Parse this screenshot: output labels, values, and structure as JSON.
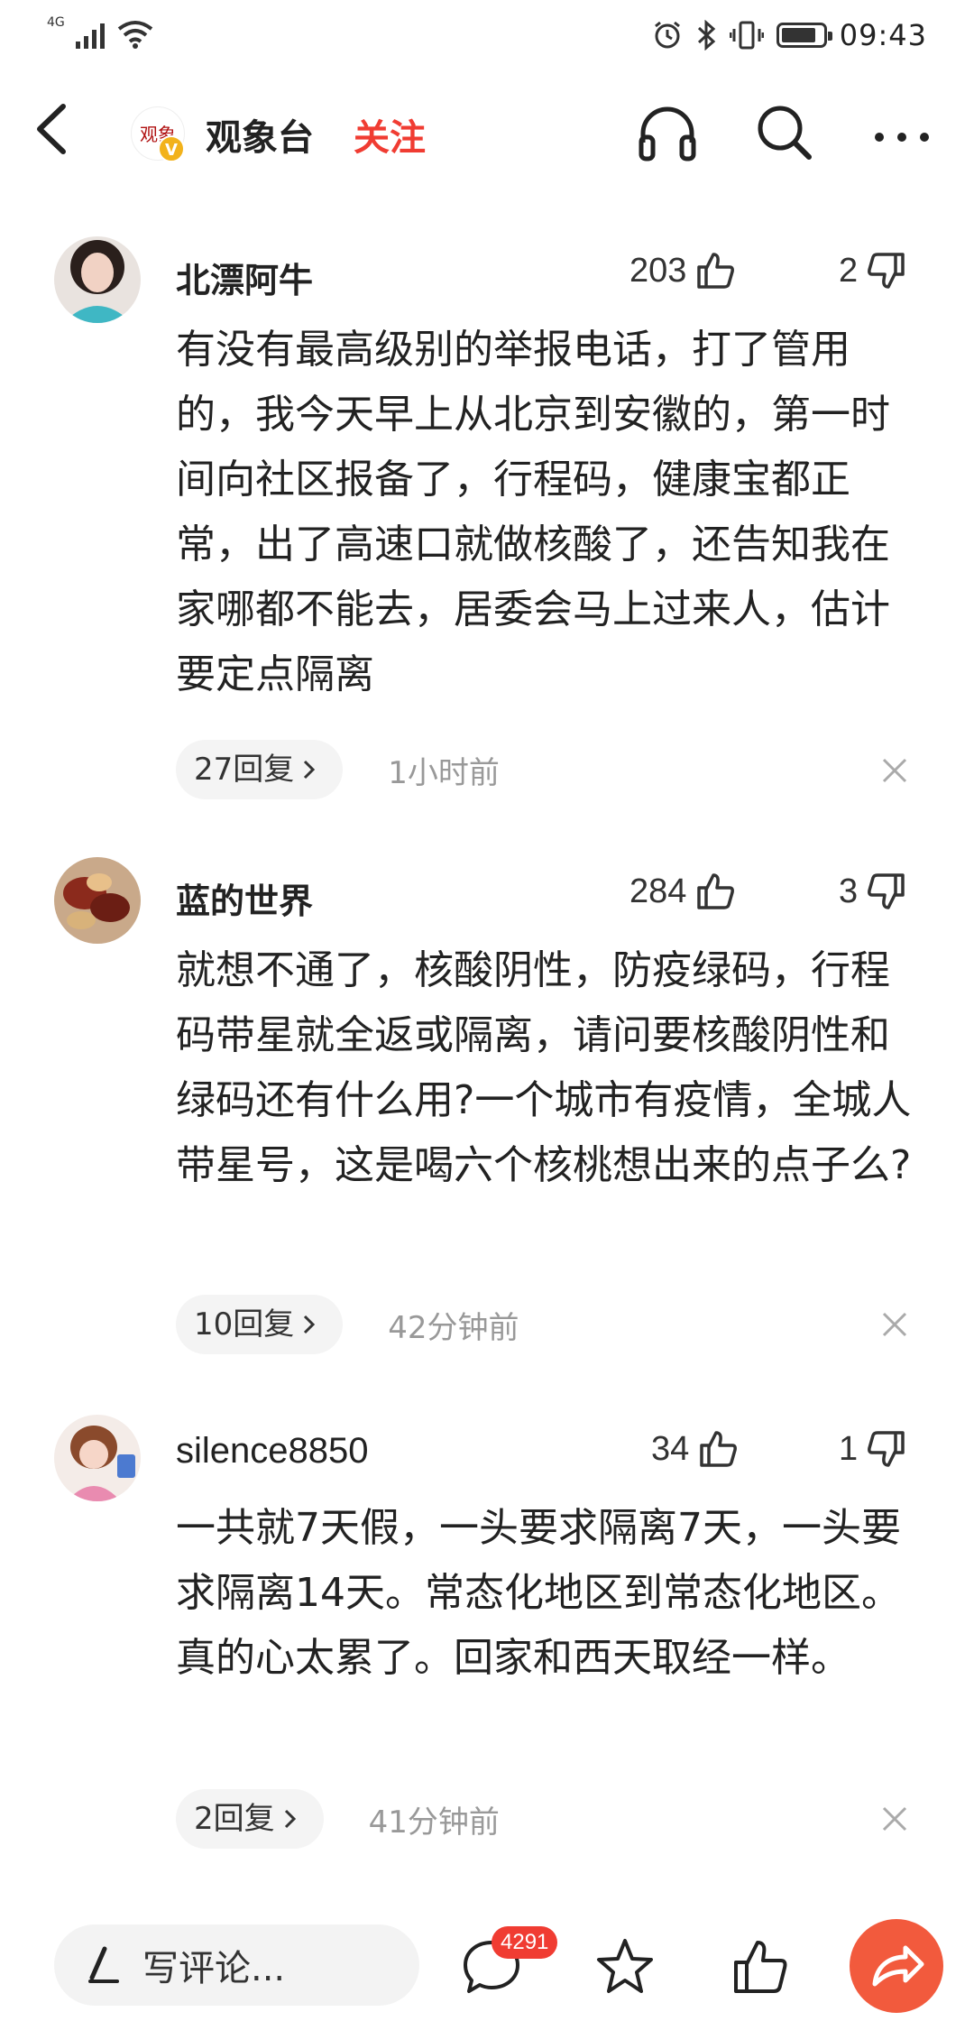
{
  "status_bar": {
    "network": "4G",
    "time": "09:43",
    "battery_level": 0.85,
    "icons": [
      "signal-icon",
      "wifi-icon",
      "alarm-icon",
      "bluetooth-icon",
      "vibrate-icon",
      "battery-icon"
    ]
  },
  "header": {
    "logo_text": "观象",
    "verified_badge": "V",
    "channel_name": "观象台",
    "follow_label": "关注",
    "icons": [
      "back-icon",
      "headphone-icon",
      "search-icon",
      "more-icon"
    ]
  },
  "comments": [
    {
      "username": "北漂阿牛",
      "likes": "203",
      "dislikes": "2",
      "text": "有没有最高级别的举报电话，打了管用的，我今天早上从北京到安徽的，第一时间向社区报备了，行程码，健康宝都正常，出了高速口就做核酸了，还告知我在家哪都不能去，居委会马上过来人，估计要定点隔离",
      "replies": "27回复",
      "time": "1小时前"
    },
    {
      "username": "蓝的世界",
      "likes": "284",
      "dislikes": "3",
      "text": "就想不通了，核酸阴性，防疫绿码，行程码带星就全返或隔离，请问要核酸阴性和绿码还有什么用?一个城市有疫情，全城人带星号，这是喝六个核桃想出来的点子么?",
      "replies": "10回复",
      "time": "42分钟前"
    },
    {
      "username": "silence8850",
      "likes": "34",
      "dislikes": "1",
      "text": "一共就7天假，一头要求隔离7天，一头要求隔离14天。常态化地区到常态化地区。真的心太累了。回家和西天取经一样。",
      "replies": "2回复",
      "time": "41分钟前"
    }
  ],
  "bottom_bar": {
    "write_placeholder": "写评论...",
    "comment_count": "4291",
    "icons": [
      "pen-icon",
      "comment-icon",
      "star-icon",
      "like-icon",
      "share-icon"
    ]
  },
  "colors": {
    "accent": "#f03c32",
    "share": "#f25a3d",
    "verified": "#f2b21b"
  }
}
